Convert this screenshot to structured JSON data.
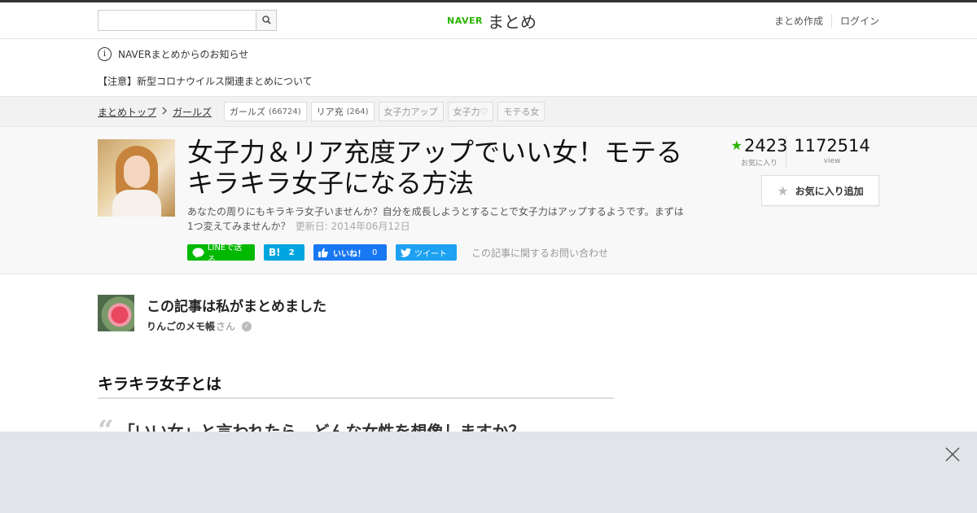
{
  "header": {
    "search_placeholder": "",
    "logo_brand": "NAVER",
    "logo_text": "まとめ",
    "links": [
      "まとめ作成",
      "ログイン"
    ]
  },
  "notices": {
    "info": "NAVERまとめからのお知らせ",
    "corona": "【注意】新型コロナウイルス関連まとめについて"
  },
  "breadcrumb": {
    "items": [
      "まとめトップ",
      "ガールズ"
    ]
  },
  "tags": [
    {
      "label": "ガールズ",
      "count": "(66724)"
    },
    {
      "label": "リア充",
      "count": "(264)"
    },
    {
      "label": "女子力アップ",
      "count": ""
    },
    {
      "label": "女子力♡",
      "count": ""
    },
    {
      "label": "モテる女",
      "count": ""
    }
  ],
  "article": {
    "title": "女子力＆リア充度アップでいい女！モテるキラキラ女子になる方法",
    "description": "あなたの周りにもキラキラ女子いませんか？自分を成長しようとすることで女子力はアップするようです。まずは1つ変えてみませんか？",
    "updated": "更新日: 2014年06月12日",
    "favorites": "2423",
    "favorites_label": "お気に入り",
    "views": "1172514",
    "views_label": "view",
    "fav_button": "お気に入り追加",
    "contact": "この記事に関するお問い合わせ"
  },
  "social": {
    "line": "LINEで送る",
    "hatena": "B!",
    "hatena_count": "2",
    "facebook": "いいね！",
    "facebook_count": "0",
    "twitter": "ツイート"
  },
  "author": {
    "heading": "この記事は私がまとめました",
    "name": "りんごのメモ帳",
    "suffix": "さん"
  },
  "section": {
    "title": "キラキラ女子とは",
    "quote_mark": "“",
    "quote": "「いい女」と言われたら、どんな女性を想像しますか？"
  },
  "colors": {
    "accent": "#2db400",
    "line": "#00b900",
    "hatena": "#00a4de",
    "facebook": "#1877f2",
    "twitter": "#1da1f2",
    "overlay": "#e1e4e8"
  }
}
